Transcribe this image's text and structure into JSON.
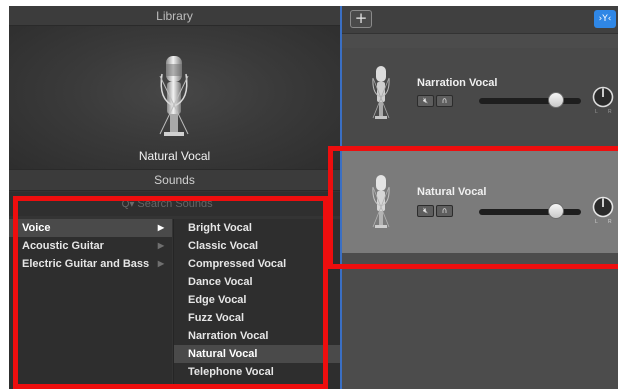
{
  "library": {
    "header": "Library",
    "hero_caption": "Natural Vocal",
    "sounds_header": "Sounds",
    "search": {
      "placeholder": "Search Sounds",
      "value": ""
    },
    "categories": [
      {
        "label": "Voice",
        "selected": true
      },
      {
        "label": "Acoustic Guitar",
        "selected": false
      },
      {
        "label": "Electric Guitar and Bass",
        "selected": false
      }
    ],
    "presets": [
      {
        "label": "Bright Vocal",
        "selected": false
      },
      {
        "label": "Classic Vocal",
        "selected": false
      },
      {
        "label": "Compressed Vocal",
        "selected": false
      },
      {
        "label": "Dance Vocal",
        "selected": false
      },
      {
        "label": "Edge Vocal",
        "selected": false
      },
      {
        "label": "Fuzz Vocal",
        "selected": false
      },
      {
        "label": "Narration Vocal",
        "selected": false
      },
      {
        "label": "Natural Vocal",
        "selected": true
      },
      {
        "label": "Telephone Vocal",
        "selected": false
      }
    ]
  },
  "tracks_toolbar": {
    "add_label": "+",
    "filter_icon": "smart-controls-icon"
  },
  "tracks": [
    {
      "name": "Narration Vocal",
      "selected": false,
      "volume": 0.8,
      "pan": 0.5
    },
    {
      "name": "Natural Vocal",
      "selected": true,
      "volume": 0.8,
      "pan": 0.5
    }
  ],
  "colors": {
    "accent_blue": "#2f87e6",
    "highlight_red": "#ee0e0e",
    "selected_track": "#7b7b7b"
  }
}
